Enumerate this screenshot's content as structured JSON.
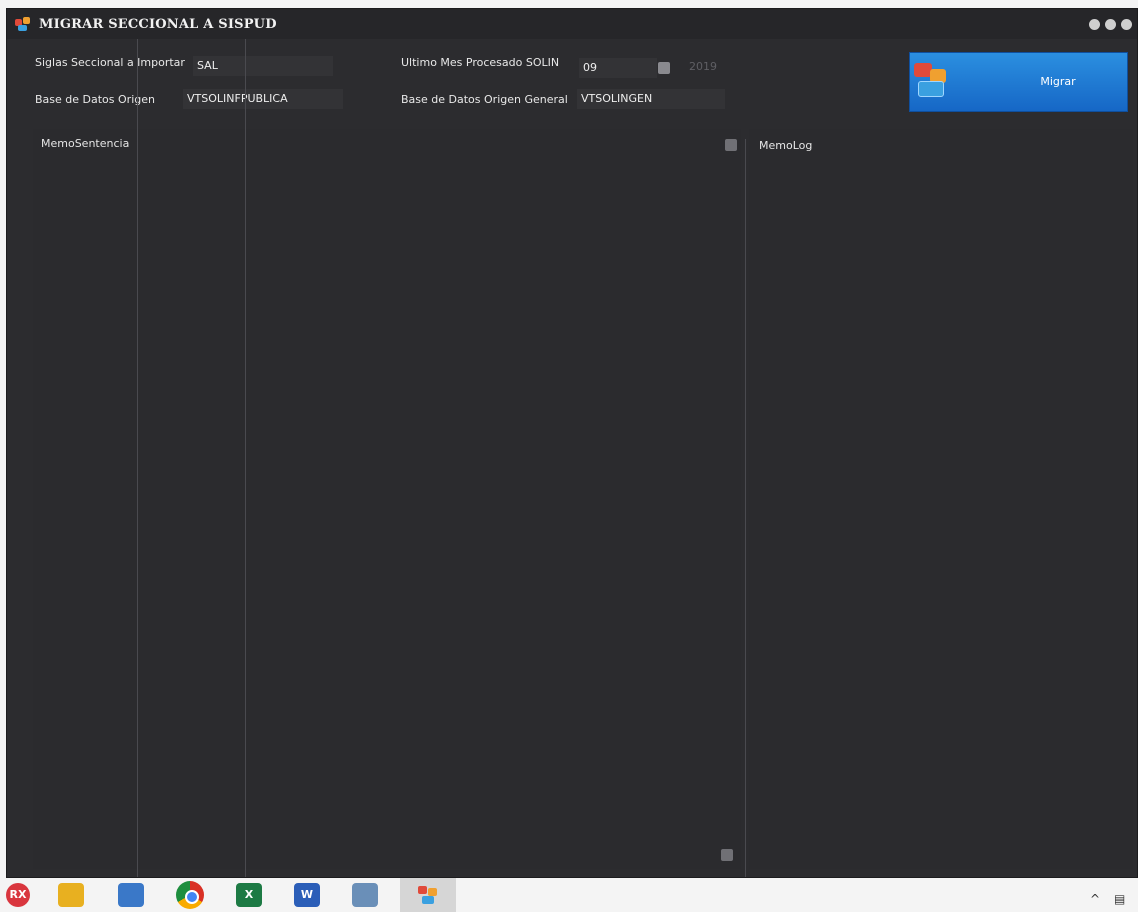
{
  "window": {
    "title": "MIGRAR SECCIONAL A SISPUD"
  },
  "form": {
    "siglas_label": "Siglas Seccional a Importar",
    "siglas_value": "SAL",
    "basedatos_label": "Base de Datos Origen",
    "basedatos_value": "VTSOLINFPUBLICA",
    "ultimo_mes_label": "Ultimo Mes Procesado SOLIN",
    "ultimo_mes_value": "09",
    "ultimo_anio_value": "2019",
    "basedatos_general_label": "Base de Datos Origen General",
    "basedatos_general_value": "VTSOLINGEN"
  },
  "migrar_button": {
    "label": "Migrar"
  },
  "memos": {
    "sentencia_label": "MemoSentencia",
    "log_label": "MemoLog"
  },
  "taskbar": {
    "rx_label": "RX",
    "excel_label": "X",
    "word_label": "W"
  },
  "icons": {
    "app": "app-icon",
    "minimize": "minimize-icon",
    "maximize": "maximize-icon",
    "close": "close-icon",
    "dropdown": "chevron-down-icon",
    "tray_up": "chevron-up-icon"
  }
}
